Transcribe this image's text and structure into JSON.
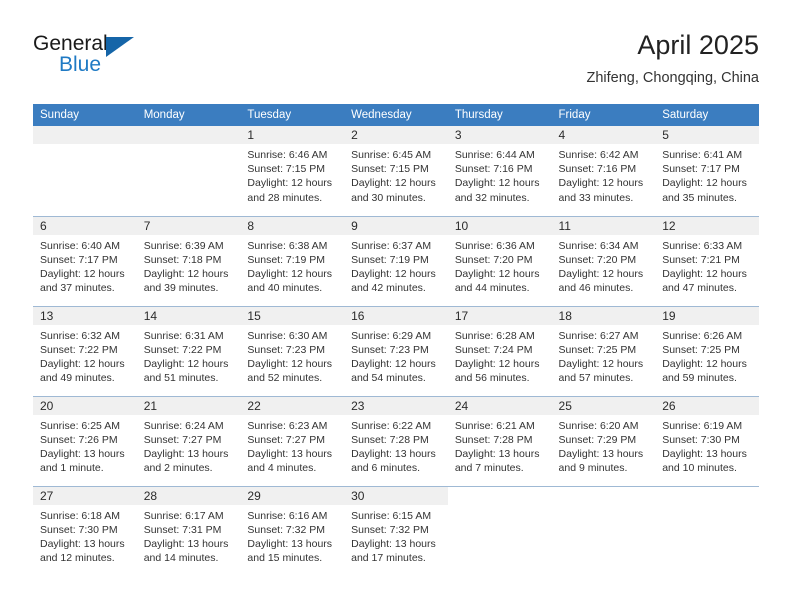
{
  "brand": {
    "name_part1": "General",
    "name_part2": "Blue",
    "logo_icon": "triangle-flag-icon",
    "accent_color": "#1f7ac4",
    "header_color": "#3b7dc0"
  },
  "header": {
    "title": "April 2025",
    "location": "Zhifeng, Chongqing, China"
  },
  "weekday_headers": [
    "Sunday",
    "Monday",
    "Tuesday",
    "Wednesday",
    "Thursday",
    "Friday",
    "Saturday"
  ],
  "labels": {
    "sunrise": "Sunrise:",
    "sunset": "Sunset:",
    "daylight": "Daylight:"
  },
  "weeks": [
    [
      {
        "day": "",
        "sunrise": "",
        "sunset": "",
        "daylight_line1": "",
        "daylight_line2": "",
        "empty": true
      },
      {
        "day": "",
        "sunrise": "",
        "sunset": "",
        "daylight_line1": "",
        "daylight_line2": "",
        "empty": true
      },
      {
        "day": "1",
        "sunrise": "Sunrise: 6:46 AM",
        "sunset": "Sunset: 7:15 PM",
        "daylight_line1": "Daylight: 12 hours",
        "daylight_line2": "and 28 minutes.",
        "empty": false
      },
      {
        "day": "2",
        "sunrise": "Sunrise: 6:45 AM",
        "sunset": "Sunset: 7:15 PM",
        "daylight_line1": "Daylight: 12 hours",
        "daylight_line2": "and 30 minutes.",
        "empty": false
      },
      {
        "day": "3",
        "sunrise": "Sunrise: 6:44 AM",
        "sunset": "Sunset: 7:16 PM",
        "daylight_line1": "Daylight: 12 hours",
        "daylight_line2": "and 32 minutes.",
        "empty": false
      },
      {
        "day": "4",
        "sunrise": "Sunrise: 6:42 AM",
        "sunset": "Sunset: 7:16 PM",
        "daylight_line1": "Daylight: 12 hours",
        "daylight_line2": "and 33 minutes.",
        "empty": false
      },
      {
        "day": "5",
        "sunrise": "Sunrise: 6:41 AM",
        "sunset": "Sunset: 7:17 PM",
        "daylight_line1": "Daylight: 12 hours",
        "daylight_line2": "and 35 minutes.",
        "empty": false
      }
    ],
    [
      {
        "day": "6",
        "sunrise": "Sunrise: 6:40 AM",
        "sunset": "Sunset: 7:17 PM",
        "daylight_line1": "Daylight: 12 hours",
        "daylight_line2": "and 37 minutes.",
        "empty": false
      },
      {
        "day": "7",
        "sunrise": "Sunrise: 6:39 AM",
        "sunset": "Sunset: 7:18 PM",
        "daylight_line1": "Daylight: 12 hours",
        "daylight_line2": "and 39 minutes.",
        "empty": false
      },
      {
        "day": "8",
        "sunrise": "Sunrise: 6:38 AM",
        "sunset": "Sunset: 7:19 PM",
        "daylight_line1": "Daylight: 12 hours",
        "daylight_line2": "and 40 minutes.",
        "empty": false
      },
      {
        "day": "9",
        "sunrise": "Sunrise: 6:37 AM",
        "sunset": "Sunset: 7:19 PM",
        "daylight_line1": "Daylight: 12 hours",
        "daylight_line2": "and 42 minutes.",
        "empty": false
      },
      {
        "day": "10",
        "sunrise": "Sunrise: 6:36 AM",
        "sunset": "Sunset: 7:20 PM",
        "daylight_line1": "Daylight: 12 hours",
        "daylight_line2": "and 44 minutes.",
        "empty": false
      },
      {
        "day": "11",
        "sunrise": "Sunrise: 6:34 AM",
        "sunset": "Sunset: 7:20 PM",
        "daylight_line1": "Daylight: 12 hours",
        "daylight_line2": "and 46 minutes.",
        "empty": false
      },
      {
        "day": "12",
        "sunrise": "Sunrise: 6:33 AM",
        "sunset": "Sunset: 7:21 PM",
        "daylight_line1": "Daylight: 12 hours",
        "daylight_line2": "and 47 minutes.",
        "empty": false
      }
    ],
    [
      {
        "day": "13",
        "sunrise": "Sunrise: 6:32 AM",
        "sunset": "Sunset: 7:22 PM",
        "daylight_line1": "Daylight: 12 hours",
        "daylight_line2": "and 49 minutes.",
        "empty": false
      },
      {
        "day": "14",
        "sunrise": "Sunrise: 6:31 AM",
        "sunset": "Sunset: 7:22 PM",
        "daylight_line1": "Daylight: 12 hours",
        "daylight_line2": "and 51 minutes.",
        "empty": false
      },
      {
        "day": "15",
        "sunrise": "Sunrise: 6:30 AM",
        "sunset": "Sunset: 7:23 PM",
        "daylight_line1": "Daylight: 12 hours",
        "daylight_line2": "and 52 minutes.",
        "empty": false
      },
      {
        "day": "16",
        "sunrise": "Sunrise: 6:29 AM",
        "sunset": "Sunset: 7:23 PM",
        "daylight_line1": "Daylight: 12 hours",
        "daylight_line2": "and 54 minutes.",
        "empty": false
      },
      {
        "day": "17",
        "sunrise": "Sunrise: 6:28 AM",
        "sunset": "Sunset: 7:24 PM",
        "daylight_line1": "Daylight: 12 hours",
        "daylight_line2": "and 56 minutes.",
        "empty": false
      },
      {
        "day": "18",
        "sunrise": "Sunrise: 6:27 AM",
        "sunset": "Sunset: 7:25 PM",
        "daylight_line1": "Daylight: 12 hours",
        "daylight_line2": "and 57 minutes.",
        "empty": false
      },
      {
        "day": "19",
        "sunrise": "Sunrise: 6:26 AM",
        "sunset": "Sunset: 7:25 PM",
        "daylight_line1": "Daylight: 12 hours",
        "daylight_line2": "and 59 minutes.",
        "empty": false
      }
    ],
    [
      {
        "day": "20",
        "sunrise": "Sunrise: 6:25 AM",
        "sunset": "Sunset: 7:26 PM",
        "daylight_line1": "Daylight: 13 hours",
        "daylight_line2": "and 1 minute.",
        "empty": false
      },
      {
        "day": "21",
        "sunrise": "Sunrise: 6:24 AM",
        "sunset": "Sunset: 7:27 PM",
        "daylight_line1": "Daylight: 13 hours",
        "daylight_line2": "and 2 minutes.",
        "empty": false
      },
      {
        "day": "22",
        "sunrise": "Sunrise: 6:23 AM",
        "sunset": "Sunset: 7:27 PM",
        "daylight_line1": "Daylight: 13 hours",
        "daylight_line2": "and 4 minutes.",
        "empty": false
      },
      {
        "day": "23",
        "sunrise": "Sunrise: 6:22 AM",
        "sunset": "Sunset: 7:28 PM",
        "daylight_line1": "Daylight: 13 hours",
        "daylight_line2": "and 6 minutes.",
        "empty": false
      },
      {
        "day": "24",
        "sunrise": "Sunrise: 6:21 AM",
        "sunset": "Sunset: 7:28 PM",
        "daylight_line1": "Daylight: 13 hours",
        "daylight_line2": "and 7 minutes.",
        "empty": false
      },
      {
        "day": "25",
        "sunrise": "Sunrise: 6:20 AM",
        "sunset": "Sunset: 7:29 PM",
        "daylight_line1": "Daylight: 13 hours",
        "daylight_line2": "and 9 minutes.",
        "empty": false
      },
      {
        "day": "26",
        "sunrise": "Sunrise: 6:19 AM",
        "sunset": "Sunset: 7:30 PM",
        "daylight_line1": "Daylight: 13 hours",
        "daylight_line2": "and 10 minutes.",
        "empty": false
      }
    ],
    [
      {
        "day": "27",
        "sunrise": "Sunrise: 6:18 AM",
        "sunset": "Sunset: 7:30 PM",
        "daylight_line1": "Daylight: 13 hours",
        "daylight_line2": "and 12 minutes.",
        "empty": false
      },
      {
        "day": "28",
        "sunrise": "Sunrise: 6:17 AM",
        "sunset": "Sunset: 7:31 PM",
        "daylight_line1": "Daylight: 13 hours",
        "daylight_line2": "and 14 minutes.",
        "empty": false
      },
      {
        "day": "29",
        "sunrise": "Sunrise: 6:16 AM",
        "sunset": "Sunset: 7:32 PM",
        "daylight_line1": "Daylight: 13 hours",
        "daylight_line2": "and 15 minutes.",
        "empty": false
      },
      {
        "day": "30",
        "sunrise": "Sunrise: 6:15 AM",
        "sunset": "Sunset: 7:32 PM",
        "daylight_line1": "Daylight: 13 hours",
        "daylight_line2": "and 17 minutes.",
        "empty": false
      },
      {
        "day": "",
        "sunrise": "",
        "sunset": "",
        "daylight_line1": "",
        "daylight_line2": "",
        "empty": true,
        "blank": true
      },
      {
        "day": "",
        "sunrise": "",
        "sunset": "",
        "daylight_line1": "",
        "daylight_line2": "",
        "empty": true,
        "blank": true
      },
      {
        "day": "",
        "sunrise": "",
        "sunset": "",
        "daylight_line1": "",
        "daylight_line2": "",
        "empty": true,
        "blank": true
      }
    ]
  ]
}
